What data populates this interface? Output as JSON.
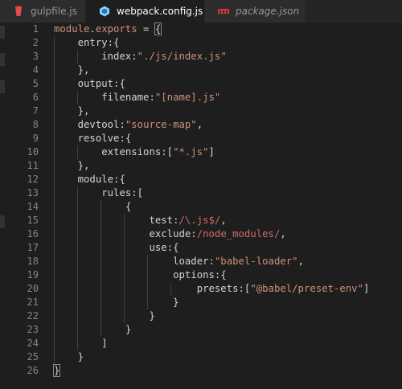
{
  "tabs": [
    {
      "label": "gulpfile.js",
      "icon": "gulp-icon",
      "active": false,
      "italic": false
    },
    {
      "label": "webpack.config.js",
      "icon": "webpack-icon",
      "active": true,
      "italic": false,
      "close": "×"
    },
    {
      "label": "package.json",
      "icon": "npm-icon",
      "active": false,
      "italic": true
    }
  ],
  "line_numbers": [
    "1",
    "2",
    "3",
    "4",
    "5",
    "6",
    "7",
    "8",
    "9",
    "10",
    "11",
    "12",
    "13",
    "14",
    "15",
    "16",
    "17",
    "18",
    "19",
    "20",
    "21",
    "22",
    "23",
    "24",
    "25",
    "26"
  ],
  "code": {
    "l1": {
      "a": "module",
      "b": ".",
      "c": "exports",
      "d": " = ",
      "e": "{"
    },
    "l2": {
      "a": "entry",
      "b": ":{"
    },
    "l3": {
      "a": "index",
      "b": ":",
      "c": "\"./js/index.js\""
    },
    "l4": {
      "a": "},"
    },
    "l5": {
      "a": "output",
      "b": ":{"
    },
    "l6": {
      "a": "filename",
      "b": ":",
      "c": "\"[name].js\""
    },
    "l7": {
      "a": "},"
    },
    "l8": {
      "a": "devtool",
      "b": ":",
      "c": "\"source-map\"",
      "d": ","
    },
    "l9": {
      "a": "resolve",
      "b": ":{"
    },
    "l10": {
      "a": "extensions",
      "b": ":[",
      "c": "\"*.js\"",
      "d": "]"
    },
    "l11": {
      "a": "},"
    },
    "l12": {
      "a": "module",
      "b": ":{"
    },
    "l13": {
      "a": "rules",
      "b": ":["
    },
    "l14": {
      "a": "{"
    },
    "l15": {
      "a": "test",
      "b": ":",
      "c": "/\\.js$/",
      "d": ","
    },
    "l16": {
      "a": "exclude",
      "b": ":",
      "c": "/node_modules/",
      "d": ","
    },
    "l17": {
      "a": "use",
      "b": ":{"
    },
    "l18": {
      "a": "loader",
      "b": ":",
      "c": "\"babel-loader\"",
      "d": ","
    },
    "l19": {
      "a": "options",
      "b": ":{"
    },
    "l20": {
      "a": "presets",
      "b": ":[",
      "c": "\"@babel/preset-env\"",
      "d": "]"
    },
    "l21": {
      "a": "}"
    },
    "l22": {
      "a": "}"
    },
    "l23": {
      "a": "}"
    },
    "l24": {
      "a": "]"
    },
    "l25": {
      "a": "}"
    },
    "l26": {
      "a": "}"
    }
  },
  "colors": {
    "background": "#1e1e1e",
    "tab_inactive": "#2d2d2d",
    "string": "#ce9178",
    "regex": "#d16969",
    "keyword_module": "#ce9178",
    "line_number": "#858585"
  }
}
